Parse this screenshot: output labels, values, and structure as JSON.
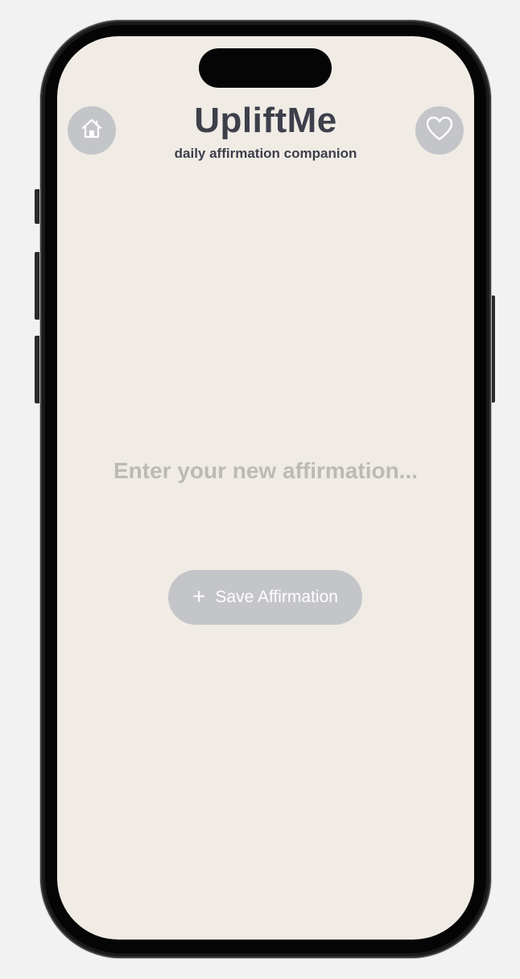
{
  "app": {
    "title": "UpliftMe",
    "subtitle": "daily affirmation companion"
  },
  "header": {
    "home_icon": "home-icon",
    "favorites_icon": "heart-icon"
  },
  "affirmation_input": {
    "value": "",
    "placeholder": "Enter your new affirmation..."
  },
  "save_button": {
    "icon": "plus-icon",
    "label": "Save Affirmation"
  },
  "colors": {
    "screen_background": "#f0ece5",
    "button_background": "#c4c5c9",
    "title_text": "#3d3f4b",
    "placeholder_text": "#bcbab5",
    "button_text": "#ffffff"
  }
}
